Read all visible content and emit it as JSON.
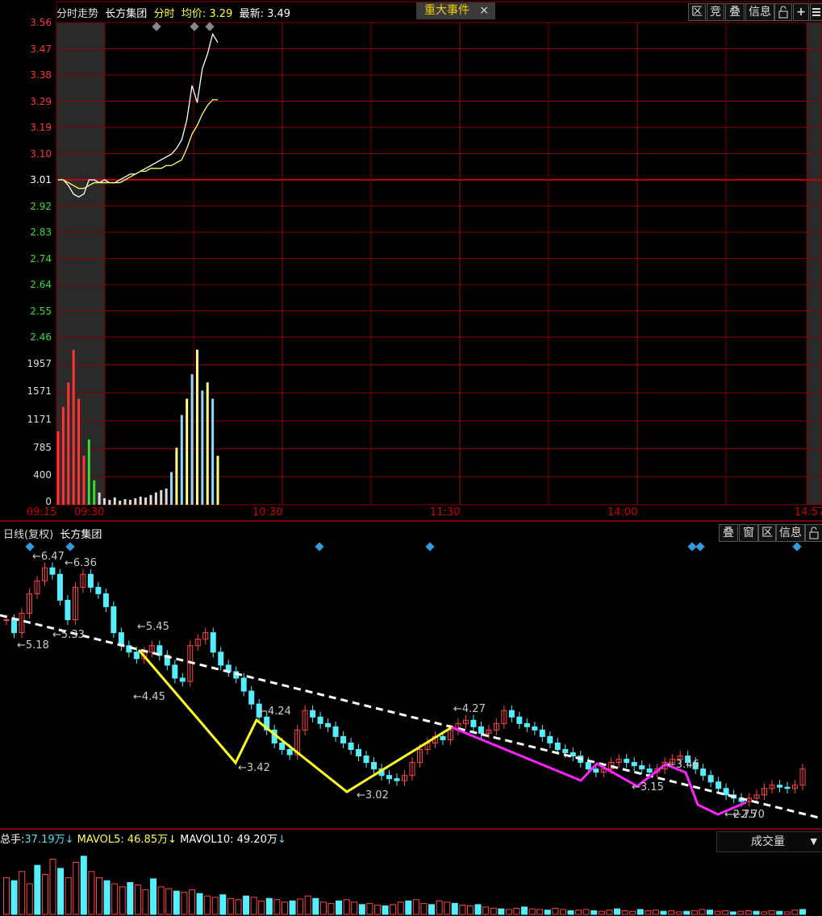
{
  "intraday": {
    "tab_label": "分时走势",
    "stock_name": "长方集团",
    "mode": "分时",
    "avg_label": "均价:",
    "avg_value": "3.29",
    "last_label": "最新:",
    "last_value": "3.49",
    "event_label": "重大事件",
    "event_close": "×",
    "toolbar": [
      "区",
      "竞",
      "叠",
      "信息",
      "lock",
      "+",
      "menu"
    ],
    "price_ticks_up": [
      "3.56",
      "3.47",
      "3.38",
      "3.29",
      "3.19",
      "3.10"
    ],
    "price_mid": "3.01",
    "price_ticks_down": [
      "2.92",
      "2.83",
      "2.74",
      "2.64",
      "2.55",
      "2.46"
    ],
    "vol_ticks": [
      "1957",
      "1571",
      "1171",
      "785",
      "400",
      "0"
    ],
    "time_ticks": [
      "09:15",
      "09:30",
      "10:30",
      "11:30",
      "14:00",
      "14:57"
    ],
    "colors": {
      "up": "#ff3333",
      "down": "#33dd33",
      "price_line": "#ffffff",
      "avg_line": "#ffff66",
      "grid": "#800000"
    }
  },
  "daily": {
    "title": "日线(复权)",
    "stock_name": "长方集团",
    "toolbar": [
      "叠",
      "窗",
      "区",
      "信息",
      "lock"
    ],
    "price_labels": [
      "6.47",
      "6.36",
      "5.18",
      "5.33",
      "5.45",
      "4.45",
      "4.24",
      "3.42",
      "3.02",
      "4.27",
      "3.15",
      "3.46",
      "2.75",
      "2.70"
    ]
  },
  "volume": {
    "total_label": "总手:",
    "total_value": "37.19万",
    "mavol5_label": "MAVOL5:",
    "mavol5_value": "46.85万",
    "mavol10_label": "MAVOL10:",
    "mavol10_value": "49.20万",
    "arrow": "↓",
    "dropdown_label": "成交量",
    "dropdown_arrow": "▼"
  },
  "chart_data": [
    {
      "type": "line",
      "x_start": "09:15",
      "x_end": "14:57",
      "ylim": [
        2.46,
        3.56
      ],
      "reference": 3.01,
      "series": [
        {
          "values": [
            3.01,
            3.01,
            2.99,
            2.96,
            2.95,
            2.96,
            3.01,
            3.01,
            3.0,
            3.01,
            3.0,
            3.0,
            3.01,
            3.02,
            3.03,
            3.03,
            3.04,
            3.05,
            3.06,
            3.07,
            3.08,
            3.09,
            3.1,
            3.12,
            3.15,
            3.22,
            3.34,
            3.28,
            3.4,
            3.45,
            3.52,
            3.49
          ]
        },
        {
          "values": [
            3.01,
            3.01,
            3.0,
            2.99,
            2.98,
            2.98,
            2.99,
            3.0,
            3.0,
            3.0,
            3.0,
            3.0,
            3.0,
            3.01,
            3.02,
            3.03,
            3.04,
            3.04,
            3.05,
            3.05,
            3.05,
            3.06,
            3.06,
            3.07,
            3.08,
            3.12,
            3.17,
            3.2,
            3.24,
            3.27,
            3.29,
            3.29
          ]
        }
      ]
    },
    {
      "type": "bar",
      "ylim": [
        0,
        1957
      ],
      "values": [
        900,
        1200,
        1500,
        1900,
        1300,
        600,
        800,
        300,
        150,
        80,
        60,
        90,
        50,
        70,
        60,
        80,
        100,
        90,
        120,
        150,
        180,
        200,
        400,
        700,
        1100,
        1300,
        1600,
        1900,
        1400,
        1500,
        1300,
        600
      ]
    },
    {
      "type": "candlestick",
      "series": [
        {
          "values": [
            5.5,
            5.3,
            5.6,
            5.9,
            6.1,
            6.3,
            6.2,
            5.8,
            5.5,
            6.0,
            6.2,
            6.0,
            5.9,
            5.7,
            5.3,
            5.1,
            5.0,
            4.9,
            5.0,
            5.1,
            4.95,
            4.8,
            4.6,
            4.55,
            5.1,
            5.2,
            5.3,
            5.0,
            4.8,
            4.7,
            4.6,
            4.4,
            4.2,
            4.0,
            3.8,
            3.6,
            3.5,
            3.42,
            3.8,
            4.1,
            4.0,
            3.9,
            3.85,
            3.7,
            3.6,
            3.5,
            3.4,
            3.3,
            3.2,
            3.1,
            3.05,
            3.02,
            3.1,
            3.3,
            3.5,
            3.6,
            3.7,
            3.65,
            3.8,
            3.9,
            3.95,
            3.85,
            3.75,
            3.8,
            3.9,
            4.1,
            4.0,
            3.9,
            3.85,
            3.8,
            3.7,
            3.6,
            3.5,
            3.45,
            3.4,
            3.3,
            3.2,
            3.15,
            3.2,
            3.3,
            3.35,
            3.3,
            3.25,
            3.2,
            3.15,
            3.2,
            3.3,
            3.35,
            3.4,
            3.3,
            3.2,
            3.1,
            3.0,
            2.9,
            2.8,
            2.75,
            2.7,
            2.75,
            2.8,
            2.9,
            2.95,
            2.92,
            2.9,
            2.95,
            3.2
          ]
        }
      ]
    },
    {
      "type": "bar",
      "values": [
        60,
        55,
        70,
        50,
        80,
        65,
        90,
        75,
        60,
        85,
        95,
        70,
        60,
        55,
        50,
        45,
        52,
        48,
        40,
        58,
        45,
        42,
        38,
        36,
        40,
        34,
        30,
        28,
        32,
        26,
        24,
        30,
        28,
        22,
        26,
        24,
        20,
        22,
        25,
        30,
        26,
        20,
        18,
        22,
        24,
        20,
        16,
        18,
        15,
        14,
        16,
        20,
        22,
        24,
        18,
        16,
        22,
        20,
        18,
        15,
        14,
        16,
        12,
        10,
        9,
        8,
        10,
        12,
        9,
        8,
        7,
        10,
        8,
        6,
        7,
        8,
        6,
        5,
        7,
        9,
        6,
        5,
        8,
        6,
        7,
        5,
        6,
        4,
        5,
        6,
        8,
        7,
        5,
        6,
        4,
        5,
        6,
        5,
        4,
        6,
        5,
        4,
        7,
        8
      ]
    }
  ]
}
